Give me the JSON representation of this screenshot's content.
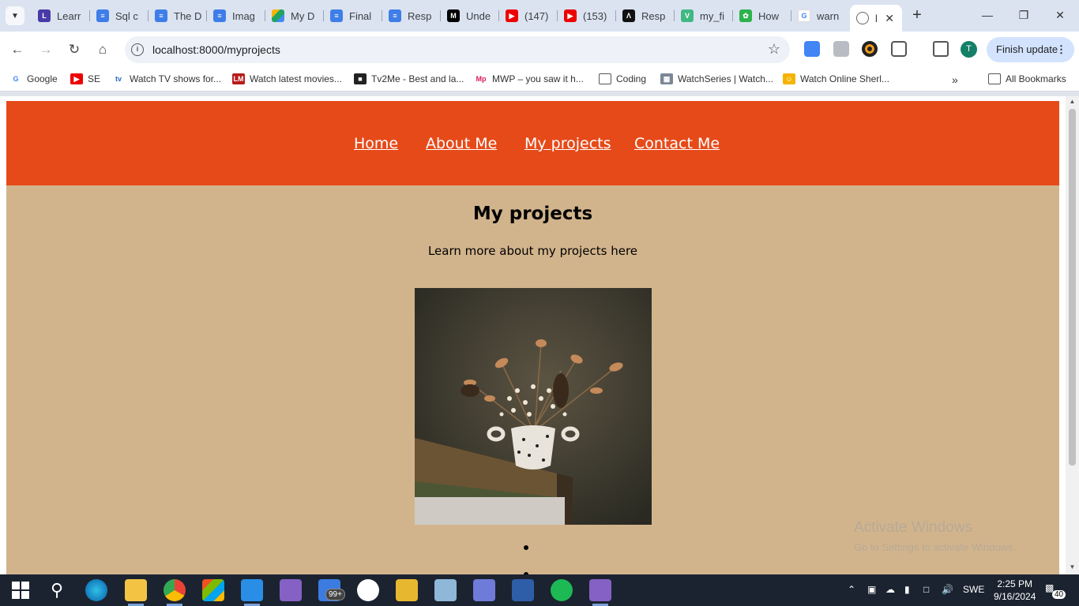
{
  "browser": {
    "tabs": [
      {
        "title": "Learr",
        "icon": "learn-icon"
      },
      {
        "title": "Sql c",
        "icon": "docs-icon"
      },
      {
        "title": "The D",
        "icon": "docs-icon"
      },
      {
        "title": "Imag",
        "icon": "docs-icon"
      },
      {
        "title": "My D",
        "icon": "drive-icon"
      },
      {
        "title": "Final",
        "icon": "docs-icon"
      },
      {
        "title": "Resp",
        "icon": "docs-icon"
      },
      {
        "title": "Unde",
        "icon": "medium-icon"
      },
      {
        "title": "(147)",
        "icon": "youtube-icon"
      },
      {
        "title": "(153)",
        "icon": "youtube-icon"
      },
      {
        "title": "Resp",
        "icon": "webflow-icon"
      },
      {
        "title": "my_fi",
        "icon": "vue-icon"
      },
      {
        "title": "How",
        "icon": "leaf-icon"
      },
      {
        "title": "warn",
        "icon": "google-icon"
      },
      {
        "title": "l",
        "icon": "globe-icon"
      }
    ],
    "url": "localhost:8000/myprojects",
    "finish_update": "Finish update",
    "avatar_letter": "T",
    "bookmarks": [
      {
        "label": "Google",
        "icon": "google-icon"
      },
      {
        "label": "SE",
        "icon": "youtube-icon"
      },
      {
        "label": "Watch TV shows for...",
        "icon": "tv-icon"
      },
      {
        "label": "Watch latest movies...",
        "icon": "lm-icon"
      },
      {
        "label": "Tv2Me - Best and la...",
        "icon": "tv2me-icon"
      },
      {
        "label": "MWP – you saw it h...",
        "icon": "mwp-icon"
      },
      {
        "label": "Coding",
        "icon": "folder-icon"
      },
      {
        "label": "WatchSeries | Watch...",
        "icon": "watchseries-icon"
      },
      {
        "label": "Watch Online Sherl...",
        "icon": "sherlock-icon"
      }
    ],
    "all_bookmarks": "All Bookmarks"
  },
  "site": {
    "nav": [
      "Home",
      "About Me",
      "My projects",
      "Contact Me"
    ],
    "title": "My projects",
    "subtitle": "Learn more about my projects here",
    "colors": {
      "header": "#e64a19",
      "background": "#d2b48c"
    }
  },
  "watermark": {
    "line1": "Activate Windows",
    "line2": "Go to Settings to activate Windows."
  },
  "taskbar": {
    "badge": "99+",
    "language": "SWE",
    "time": "2:25 PM",
    "date": "9/16/2024",
    "notifications": "40"
  }
}
